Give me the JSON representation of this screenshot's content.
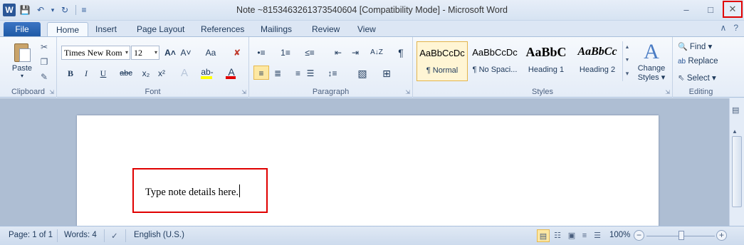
{
  "window": {
    "title": "Note ~8153463261373540604 [Compatibility Mode]  -  Microsoft Word",
    "app_logo": "W"
  },
  "quick_access": {
    "save_icon": "💾",
    "undo_icon": "↶",
    "undo_dropdown": "▾",
    "redo_icon": "↻",
    "customize": "≡"
  },
  "window_controls": {
    "minimize": "–",
    "restore": "□",
    "close": "✕"
  },
  "tabs": [
    {
      "label": "File"
    },
    {
      "label": "Home"
    },
    {
      "label": "Insert"
    },
    {
      "label": "Page Layout"
    },
    {
      "label": "References"
    },
    {
      "label": "Mailings"
    },
    {
      "label": "Review"
    },
    {
      "label": "View"
    }
  ],
  "tabrow_icons": {
    "minimize_ribbon": "∧",
    "help": "?"
  },
  "clipboard": {
    "label": "Clipboard",
    "paste": "Paste",
    "paste_arrow": "▾",
    "cut_icon": "✂",
    "copy_icon": "❐",
    "format_painter_icon": "✎"
  },
  "font": {
    "label": "Font",
    "name": "Times New Rom",
    "size": "12",
    "grow": "A˄",
    "shrink": "A˅",
    "change_case": "Aa",
    "clear_format": "✘",
    "bold": "B",
    "italic": "I",
    "underline": "U",
    "strikethrough": "abc",
    "subscript": "x₂",
    "superscript": "x²",
    "text_effects": "A",
    "highlight": "ab‑",
    "font_color": "A",
    "highlight_color": "#ffff00",
    "font_color_value": "#e00000"
  },
  "paragraph": {
    "label": "Paragraph",
    "bullets": "•≡",
    "numbering": "1≡",
    "multilevel": "≤≡",
    "decrease_indent": "⇤",
    "increase_indent": "⇥",
    "sort": "A↓Z",
    "show_marks": "¶",
    "align_left": "≡",
    "align_center": "≣",
    "align_right": "≡",
    "justify": "☰",
    "line_spacing": "↕≡",
    "shading": "▧",
    "borders": "⊞"
  },
  "styles": {
    "label": "Styles",
    "items": [
      {
        "sample": "AaBbCcDc",
        "name": "¶ Normal"
      },
      {
        "sample": "AaBbCcDc",
        "name": "¶ No Spaci..."
      },
      {
        "sample": "AaBbC",
        "name": "Heading 1"
      },
      {
        "sample": "AaBbCc",
        "name": "Heading 2"
      }
    ],
    "scroll_up": "▲",
    "scroll_down": "▼",
    "more": "▾",
    "change_styles_icon": "A",
    "change_styles_line1": "Change",
    "change_styles_line2": "Styles ▾"
  },
  "editing": {
    "label": "Editing",
    "find": "Find ▾",
    "replace": "Replace",
    "select": "Select ▾",
    "find_icon": "🔍",
    "replace_icon": "ab",
    "select_icon": "⇖"
  },
  "document": {
    "body_text": "Type note details here."
  },
  "status": {
    "page": "Page: 1 of 1",
    "words": "Words: 4",
    "proofing_icon": "✓",
    "language": "English (U.S.)",
    "zoom": "100%",
    "zoom_out": "−",
    "zoom_in": "+",
    "zoom_level_percent": 100
  }
}
